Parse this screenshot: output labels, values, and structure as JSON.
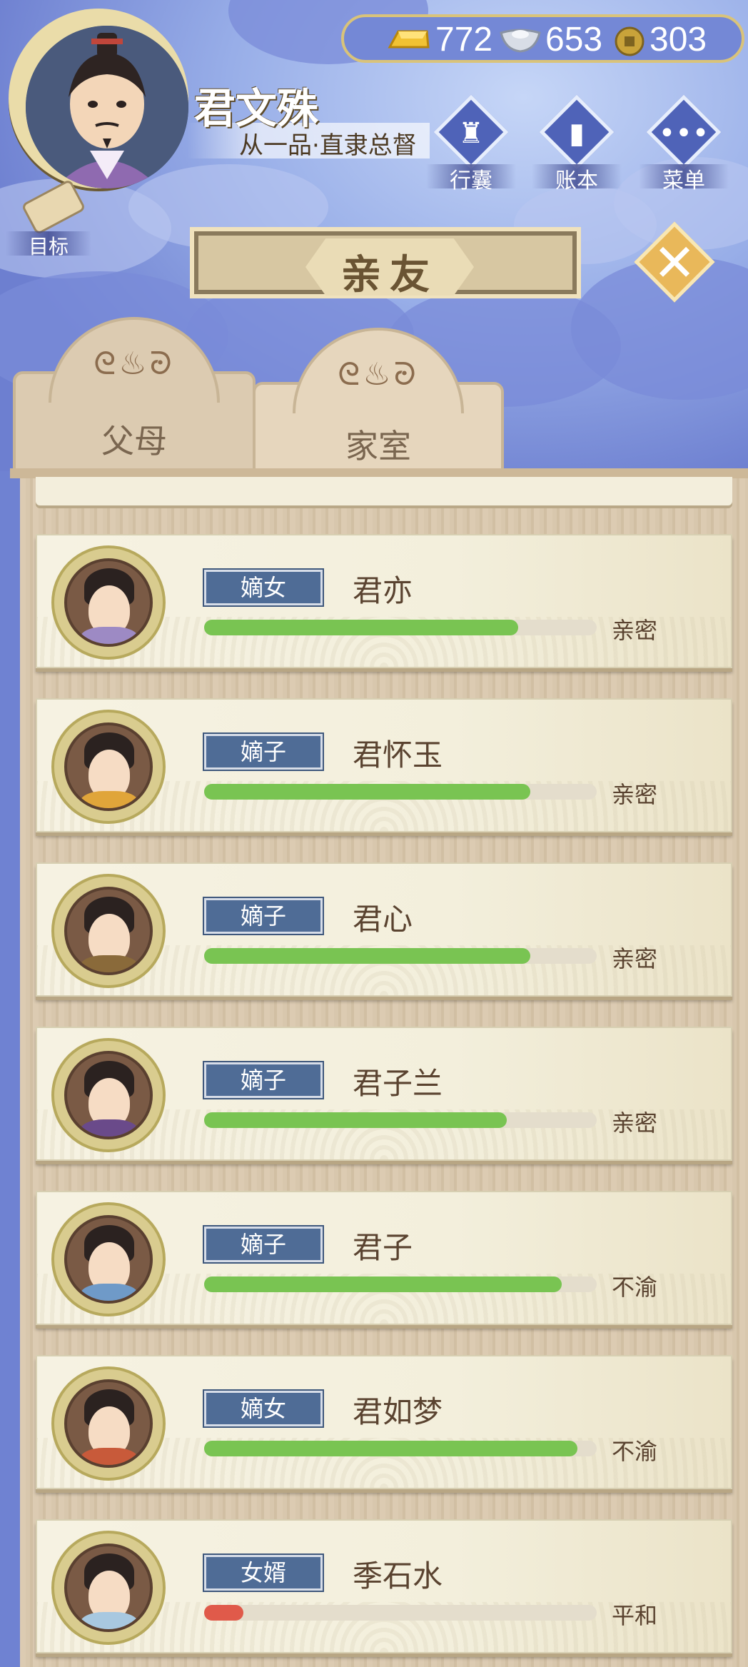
{
  "currency": {
    "gold": "772",
    "silver": "653",
    "coins": "303"
  },
  "player": {
    "name": "君文殊",
    "rank": "从一品·直隶总督"
  },
  "top_buttons": [
    {
      "label": "行囊",
      "icon": "bag-icon"
    },
    {
      "label": "账本",
      "icon": "ledger-icon"
    },
    {
      "label": "菜单",
      "icon": "menu-icon"
    }
  ],
  "goal_label": "目标",
  "page_title": "亲友",
  "tabs": [
    {
      "label": "父母",
      "active": false
    },
    {
      "label": "家室",
      "active": true
    }
  ],
  "members": [
    {
      "role": "嫡女",
      "name": "君亦",
      "relation": "亲密",
      "progress": 0.8,
      "robe": "#9d8ac4",
      "hair_accent": "#4f86d0"
    },
    {
      "role": "嫡子",
      "name": "君怀玉",
      "relation": "亲密",
      "progress": 0.83,
      "robe": "#e0a53a",
      "hair_accent": "#c0463b"
    },
    {
      "role": "嫡子",
      "name": "君心",
      "relation": "亲密",
      "progress": 0.83,
      "robe": "#8a6a3a",
      "hair_accent": "#2b2220"
    },
    {
      "role": "嫡子",
      "name": "君子兰",
      "relation": "亲密",
      "progress": 0.77,
      "robe": "#6a4a8a",
      "hair_accent": "#2b2220"
    },
    {
      "role": "嫡子",
      "name": "君子",
      "relation": "不渝",
      "progress": 0.91,
      "robe": "#6f9ac8",
      "hair_accent": "#3a5a8a"
    },
    {
      "role": "嫡女",
      "name": "君如梦",
      "relation": "不渝",
      "progress": 0.95,
      "robe": "#c85a3a",
      "hair_accent": "#d06aa8"
    },
    {
      "role": "女婿",
      "name": "季石水",
      "relation": "平和",
      "progress": 0.1,
      "robe": "#a8c8e0",
      "hair_accent": "#8a6ad0"
    }
  ]
}
